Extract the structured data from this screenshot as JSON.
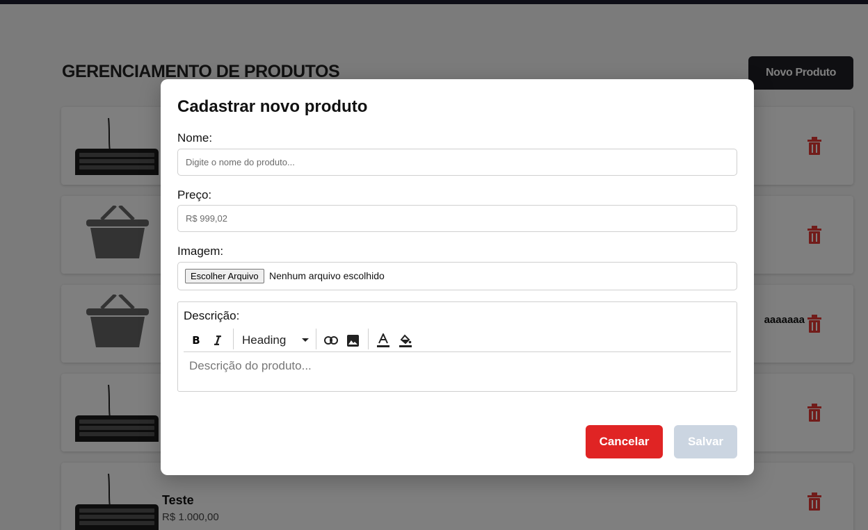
{
  "page": {
    "title": "GERENCIAMENTO DE PRODUTOS",
    "new_product_label": "Novo Produto"
  },
  "products": [
    {
      "name": "",
      "price": "",
      "extra": "",
      "image": "keyboard-image"
    },
    {
      "name": "",
      "price": "",
      "extra": "",
      "image": "basket-placeholder-image"
    },
    {
      "name": "",
      "price": "",
      "extra": "aaaaaaa",
      "image": "basket-placeholder-image"
    },
    {
      "name": "",
      "price": "",
      "extra": "",
      "image": "keyboard-image"
    },
    {
      "name": "Teste",
      "price": "R$ 1.000,00",
      "extra": "",
      "image": "keyboard-image"
    }
  ],
  "modal": {
    "title": "Cadastrar novo produto",
    "name_label": "Nome:",
    "name_placeholder": "Digite o nome do produto...",
    "name_value": "",
    "price_label": "Preço:",
    "price_placeholder": "R$ 999,02",
    "price_value": "",
    "image_label": "Imagem:",
    "file_button_label": "Escolher Arquivo",
    "file_status": "Nenhum arquivo escolhido",
    "description_label": "Descrição:",
    "heading_select_value": "Heading",
    "description_placeholder": "Descrição do produto...",
    "cancel_label": "Cancelar",
    "save_label": "Salvar"
  },
  "colors": {
    "danger": "#e02424",
    "disabled": "#cbd5e1",
    "dark_button": "#1e1e24",
    "trash_icon": "#e53935"
  }
}
